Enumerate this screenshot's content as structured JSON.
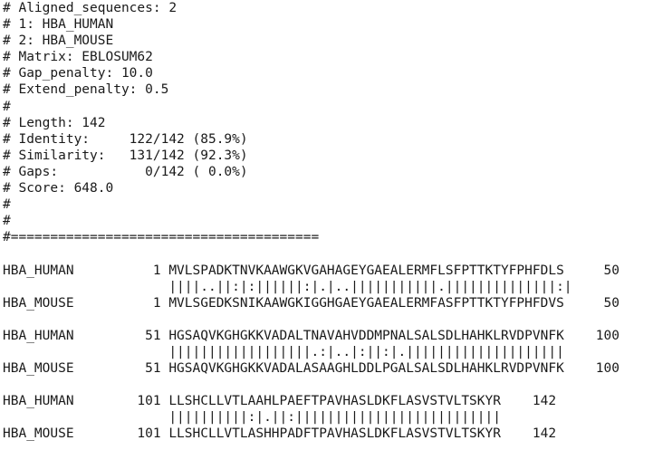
{
  "header": {
    "lines": [
      "# Aligned_sequences: 2",
      "# 1: HBA_HUMAN",
      "# 2: HBA_MOUSE",
      "# Matrix: EBLOSUM62",
      "# Gap_penalty: 10.0",
      "# Extend_penalty: 0.5",
      "#",
      "# Length: 142",
      "# Identity:     122/142 (85.9%)",
      "# Similarity:   131/142 (92.3%)",
      "# Gaps:           0/142 ( 0.0%)",
      "# Score: 648.0",
      "#",
      "#",
      "#======================================="
    ]
  },
  "alignment": {
    "lines": [
      "",
      "HBA_HUMAN          1 MVLSPADKTNVKAAWGKVGAHAGEYGAEALERMFLSFPTTKTYFPHFDLS     50",
      "                     ||||..||:|:||||||:|.|..|||||||||||.||||||||||||||:|",
      "HBA_MOUSE          1 MVLSGEDKSNIKAAWGKIGGHGAEYGAEALERMFASFPTTKTYFPHFDVS     50",
      "",
      "HBA_HUMAN         51 HGSAQVKGHGKKVADALTNAVAHVDDMPNALSALSDLHAHKLRVDPVNFK    100",
      "                     ||||||||||||||||||.:|..|:||:|.||||||||||||||||||||",
      "HBA_MOUSE         51 HGSAQVKGHGKKVADALASAAGHLDDLPGALSALSDLHAHKLRVDPVNFK    100",
      "",
      "HBA_HUMAN        101 LLSHCLLVTLAAHLPAEFTPAVHASLDKFLASVSTVLTSKYR    142",
      "                     ||||||||||:|.||:||||||||||||||||||||||||||",
      "HBA_MOUSE        101 LLSHCLLVTLASHHPADFTPAVHASLDKFLASVSTVLTSKYR    142"
    ]
  }
}
